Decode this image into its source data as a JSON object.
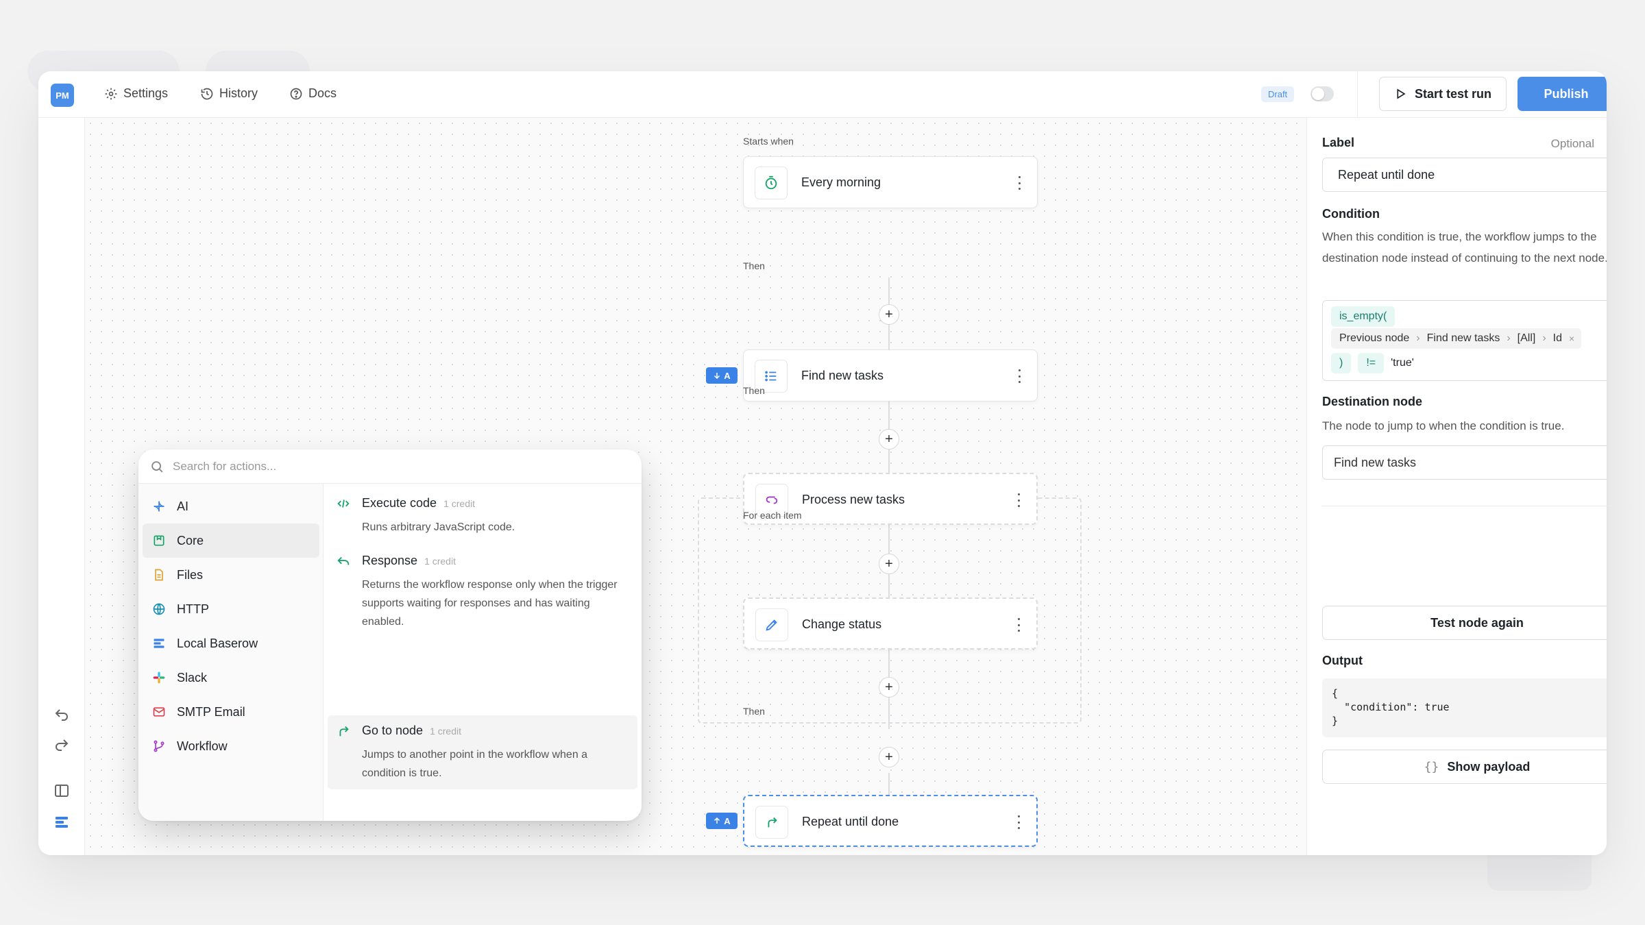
{
  "app": {
    "logo_text": "PM"
  },
  "topbar": {
    "nav": [
      {
        "label": "Settings",
        "icon": "gear-icon"
      },
      {
        "label": "History",
        "icon": "history-icon"
      },
      {
        "label": "Docs",
        "icon": "help-icon"
      }
    ],
    "status_badge": "Draft",
    "test_run_label": "Start test run",
    "publish_label": "Publish"
  },
  "workflow": {
    "trigger_heading": "Starts when",
    "then_label": "Then",
    "for_each_label": "For each item",
    "nodes": [
      {
        "title": "Every morning",
        "icon": "timer-icon"
      },
      {
        "title": "Find new tasks",
        "icon": "list-icon",
        "badge": "A"
      },
      {
        "title": "Process new tasks",
        "icon": "loop-icon"
      },
      {
        "title": "Change status",
        "icon": "pencil-icon"
      },
      {
        "title": "Repeat until done",
        "icon": "jump-arrow-icon",
        "badge": "A"
      }
    ]
  },
  "action_picker": {
    "search_placeholder": "Search for actions...",
    "categories": [
      {
        "label": "AI",
        "icon": "sparkle-icon"
      },
      {
        "label": "Core",
        "icon": "core-icon",
        "selected": true
      },
      {
        "label": "Files",
        "icon": "file-icon"
      },
      {
        "label": "HTTP",
        "icon": "globe-icon"
      },
      {
        "label": "Local Baserow",
        "icon": "baserow-icon"
      },
      {
        "label": "Slack",
        "icon": "slack-icon"
      },
      {
        "label": "SMTP Email",
        "icon": "mail-icon"
      },
      {
        "label": "Workflow",
        "icon": "branch-icon"
      }
    ],
    "actions": [
      {
        "title": "Execute code",
        "credit": "1 credit",
        "description": "Runs arbitrary JavaScript code.",
        "icon": "code-icon"
      },
      {
        "title": "Response",
        "credit": "1 credit",
        "description": "Returns the workflow response only when the trigger supports waiting for responses and has waiting enabled.",
        "icon": "reply-icon"
      },
      {
        "title": "Go to node",
        "credit": "1 credit",
        "description": "Jumps to another point in the workflow when a condition is true.",
        "icon": "jump-arrow-icon"
      }
    ]
  },
  "zoom": {
    "zoom_in": "+",
    "zoom_out": "–"
  },
  "panel": {
    "label_heading": "Label",
    "label_optional": "Optional",
    "label_value": "Repeat until done",
    "condition_heading": "Condition",
    "condition_help": "When this condition is true, the workflow jumps to the destination node instead of continuing to the next node.",
    "formula": {
      "fn_open": "is_empty(",
      "path": [
        "Previous node",
        "Find new tasks",
        "[All]",
        "Id"
      ],
      "fn_close": ")",
      "operator": "!=",
      "literal": "'true'"
    },
    "destination_heading": "Destination node",
    "destination_help": "The node to jump to when the condition is true.",
    "destination_value": "Find new tasks",
    "test_again_label": "Test node again",
    "output_heading": "Output",
    "output_code": "{\n  \"condition\": true\n}",
    "show_payload_label": "Show payload",
    "payload_icon_text": "{}"
  },
  "colors": {
    "accent": "#4a8ee8",
    "badge": "#3b82e6",
    "formula_green": "#1b7e6e"
  }
}
